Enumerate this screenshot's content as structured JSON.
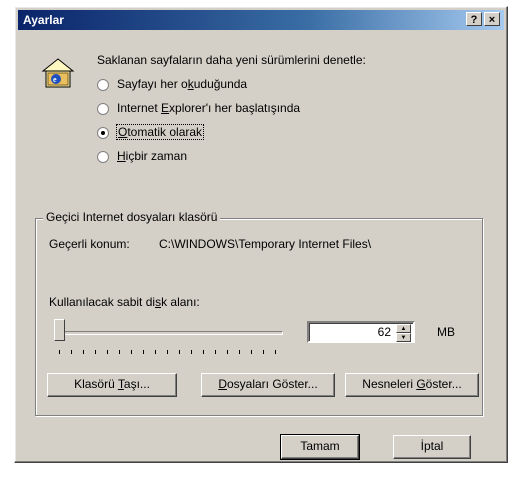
{
  "window": {
    "title": "Ayarlar",
    "help_button": "?",
    "close_button": "×"
  },
  "check_section": {
    "prompt": "Saklanan sayfaların daha yeni sürümlerini denetle:",
    "options": [
      {
        "pre": "Sayfayı her o",
        "ul": "k",
        "post": "uduğunda",
        "checked": false
      },
      {
        "pre": "Internet ",
        "ul": "E",
        "post": "xplorer'ı her başlatışında",
        "checked": false
      },
      {
        "pre": "",
        "ul": "O",
        "post": "tomatik olarak",
        "checked": true
      },
      {
        "pre": "",
        "ul": "H",
        "post": "içbir zaman",
        "checked": false
      }
    ]
  },
  "temp_folder": {
    "group_label": "Geçici Internet dosyaları klasörü",
    "location_label": "Geçerli konum:",
    "location_value": "C:\\WINDOWS\\Temporary Internet Files\\",
    "disk_label_pre": "Kullanılacak sabit di",
    "disk_label_ul": "s",
    "disk_label_post": "k alanı:",
    "disk_value": "62",
    "disk_unit": "MB",
    "slider_level": 0.0,
    "move_button": {
      "pre": "Klasörü ",
      "ul": "T",
      "post": "aşı..."
    },
    "view_files_button": {
      "pre": "",
      "ul": "D",
      "post": "osyaları Göster..."
    },
    "view_objects_button": {
      "pre": "Nesneleri ",
      "ul": "G",
      "post": "öster..."
    }
  },
  "footer": {
    "ok_label": "Tamam",
    "cancel_label": "İptal"
  },
  "colors": {
    "titlebar_start": "#0a246a",
    "titlebar_end": "#a6caf0",
    "face": "#d4d0c8"
  },
  "icons": {
    "dialog_icon": "house-ie-icon"
  }
}
